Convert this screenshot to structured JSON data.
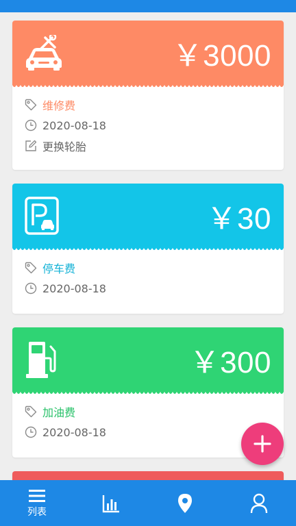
{
  "status_bar": {
    "color": "#1e88e5"
  },
  "records": [
    {
      "icon": "car-repair-icon",
      "accent": "#fe8a65",
      "amount": "￥3000",
      "category": "维修费",
      "date": "2020-08-18",
      "note": "更换轮胎"
    },
    {
      "icon": "parking-icon",
      "accent": "#13c5e8",
      "amount": "￥30",
      "category": "停车费",
      "date": "2020-08-18"
    },
    {
      "icon": "gas-station-icon",
      "accent": "#2fd474",
      "amount": "￥300",
      "category": "加油费",
      "date": "2020-08-18"
    },
    {
      "accent": "#ef5b5b"
    }
  ],
  "fab": {
    "icon": "plus-icon",
    "color": "#ee3d7b"
  },
  "bottom_nav": {
    "color": "#1e88e5",
    "items": [
      {
        "icon": "list-icon",
        "label": "列表"
      },
      {
        "icon": "bar-chart-icon"
      },
      {
        "icon": "location-pin-icon"
      },
      {
        "icon": "user-icon"
      }
    ]
  }
}
